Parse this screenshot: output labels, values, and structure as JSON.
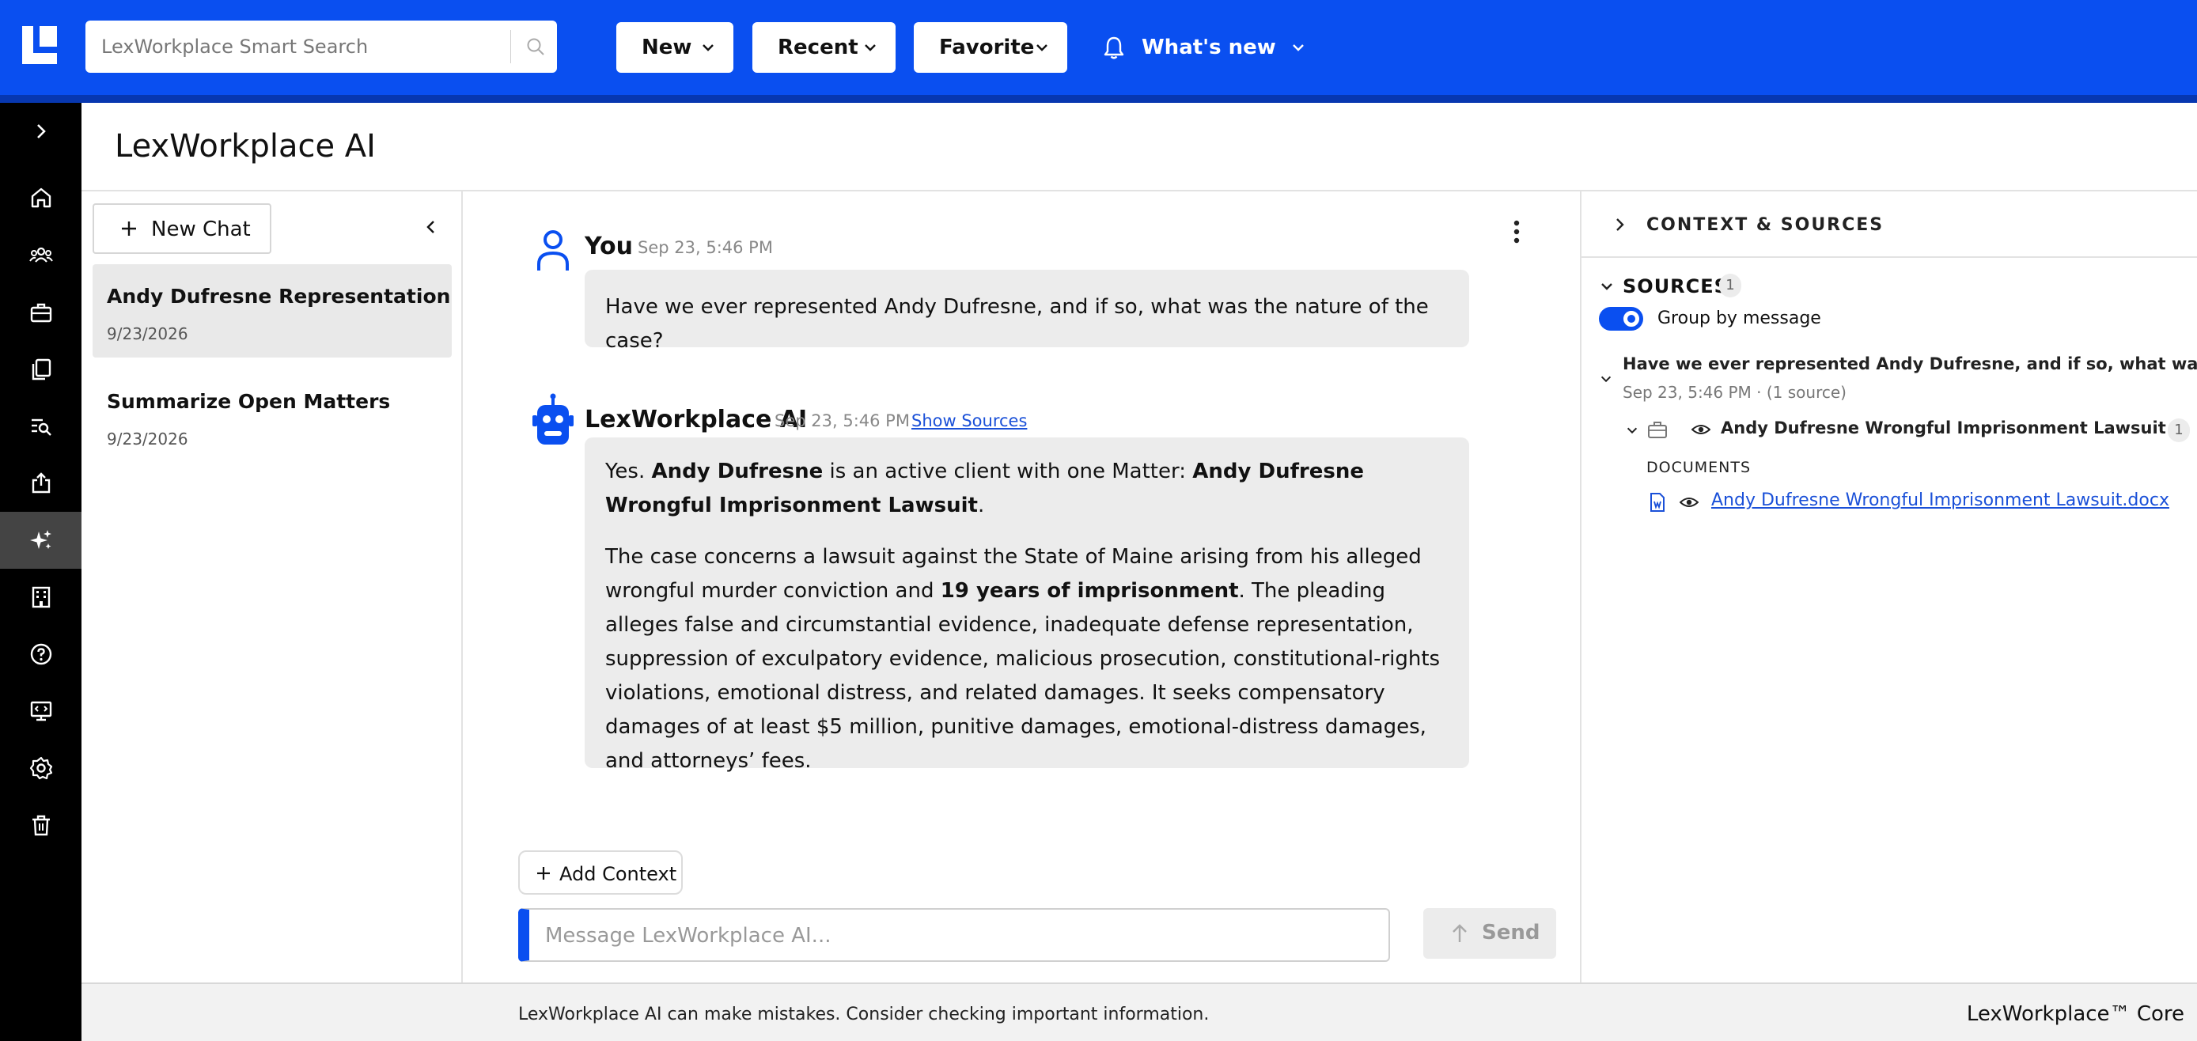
{
  "app": {
    "title": "LexWorkplace AI",
    "search_placeholder": "LexWorkplace Smart Search",
    "brand": "LexWorkplace™ Core",
    "accent_color": "#0a4ff0"
  },
  "topnav": {
    "new_label": "New",
    "recent_label": "Recent",
    "favorite_label": "Favorite",
    "whats_new_label": "What's new"
  },
  "rail": {
    "items": [
      "expand-icon",
      "home-icon",
      "clients-icon",
      "matters-icon",
      "documents-icon",
      "search-icon",
      "share-icon",
      "ai-icon",
      "firm-icon",
      "help-icon",
      "admin-icon",
      "settings-icon",
      "trash-icon"
    ],
    "active": "ai-icon"
  },
  "chatlist": {
    "new_chat_label": "New Chat",
    "chats": [
      {
        "title": "Andy Dufresne Representation",
        "date": "9/23/2026"
      },
      {
        "title": "Summarize Open Matters",
        "date": "9/23/2026"
      }
    ]
  },
  "conversation": {
    "user_name": "You",
    "user_time": "Sep 23, 5:46 PM",
    "user_message": "Have we ever represented Andy Dufresne, and if so, what was the nature of the case?",
    "ai_name": "LexWorkplace AI",
    "ai_time": "Sep 23, 5:46 PM",
    "show_sources_label": "Show Sources",
    "ai_p1_a": "Yes. ",
    "ai_p1_b": "Andy Dufresne",
    "ai_p1_c": " is an active client with one Matter: ",
    "ai_p1_d": "Andy Dufresne Wrongful Imprisonment Lawsuit",
    "ai_p1_e": ".",
    "ai_p2_a": "The case concerns a lawsuit against the State of Maine arising from his alleged wrongful murder conviction and ",
    "ai_p2_b": "19 years of imprisonment",
    "ai_p2_c": ". The pleading alleges false and circumstantial evidence, inadequate defense representation, suppression of exculpatory evidence, malicious prosecution, constitutional-rights violations, emotional distress, and related damages. It seeks compensatory damages of at least $5 million, punitive damages, emotional-distress damages, and attorneys’ fees.",
    "add_context_label": "Add Context",
    "message_placeholder": "Message LexWorkplace AI...",
    "send_label": "Send"
  },
  "context": {
    "header": "CONTEXT & SOURCES",
    "sources_label": "SOURCES",
    "sources_count": "1",
    "group_by_label": "Group by message",
    "group_by_on": true,
    "message_title": "Have we ever represented Andy Dufresne, and if so, what was th...",
    "message_meta": "Sep 23, 5:46 PM · (1 source)",
    "matter_name": "Andy Dufresne Wrongful Imprisonment Lawsuit",
    "matter_count": "1",
    "documents_label": "DOCUMENTS",
    "document_name": "Andy Dufresne Wrongful Imprisonment Lawsuit.docx"
  },
  "footer": {
    "disclaimer": "LexWorkplace AI can make mistakes. Consider checking important information."
  }
}
